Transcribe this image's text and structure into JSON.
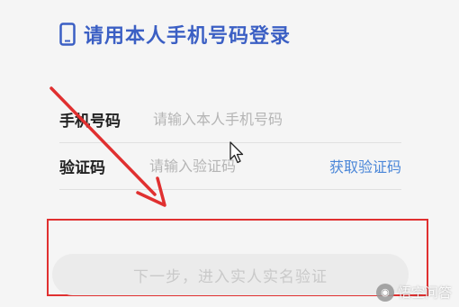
{
  "header": {
    "title": "请用本人手机号码登录",
    "icon": "phone-icon"
  },
  "form": {
    "phone": {
      "label": "手机号码",
      "placeholder": "请输入本人手机号码",
      "value": ""
    },
    "code": {
      "label": "验证码",
      "placeholder": "请输入验证码",
      "value": "",
      "get_code_label": "获取验证码"
    }
  },
  "next_button": {
    "label": "下一步，进入实人实名验证"
  },
  "watermark": {
    "text": "悟空问答"
  },
  "colors": {
    "title": "#3b5fc4",
    "link": "#4a86d8",
    "annotation": "#e03030"
  }
}
